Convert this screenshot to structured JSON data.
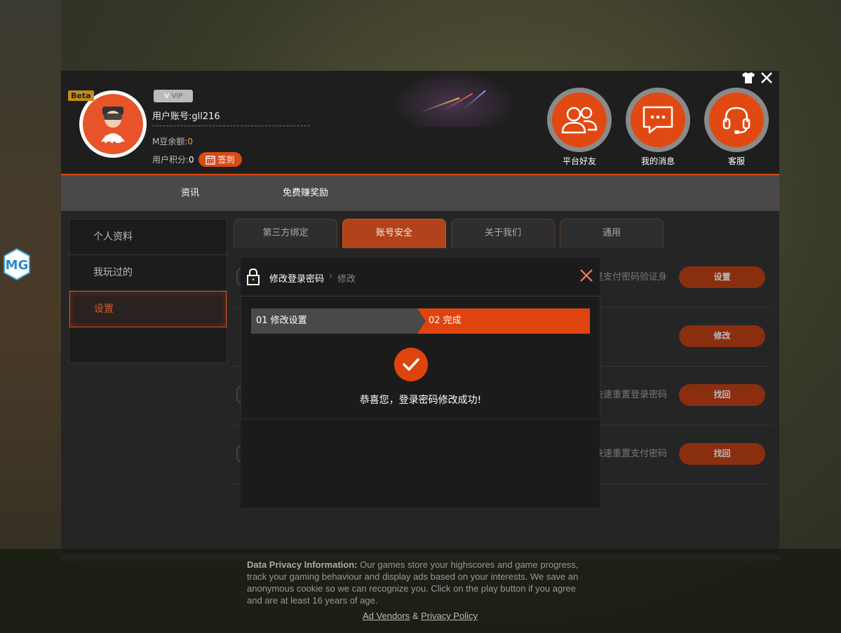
{
  "header": {
    "beta_badge": "Beta",
    "vip_label": "VIP",
    "account_label": "用户账号:",
    "account_value": "gll216",
    "balance_label": "M豆余额:",
    "balance_value": "0",
    "points_label": "用户积分:",
    "points_value": "0",
    "signin_label": "签到",
    "friends_label": "平台好友",
    "messages_label": "我的消息",
    "service_label": "客服"
  },
  "nav": {
    "items": [
      {
        "label": "资讯"
      },
      {
        "label": "免费赚奖励"
      }
    ]
  },
  "sidebar": {
    "items": [
      {
        "label": "个人资料",
        "active": false
      },
      {
        "label": "我玩过的",
        "active": false
      },
      {
        "label": "设置",
        "active": true
      }
    ]
  },
  "tabs": [
    {
      "label": "第三方绑定",
      "active": false
    },
    {
      "label": "账号安全",
      "active": true
    },
    {
      "label": "关于我们",
      "active": false
    },
    {
      "label": "通用",
      "active": false
    }
  ],
  "rows": [
    {
      "text": "是支付密码验证身",
      "button": "设置"
    },
    {
      "text": "",
      "button": "修改"
    },
    {
      "text": "快速重置登录密码",
      "button": "找回"
    },
    {
      "text": "快速重置支付密码",
      "button": "找回"
    }
  ],
  "modal": {
    "title": "修改登录密码",
    "separator": "›",
    "subtitle": "修改",
    "step1": "01 修改设置",
    "step2": "02 完成",
    "success": "恭喜您，登录密码修改成功!"
  },
  "privacy": {
    "heading": "Data Privacy Information:",
    "body": " Our games store your highscores and game progress, track your gaming behaviour and display ads based on your interests. We save an anonymous cookie so we can recognize you. Click on the play button if you agree and are at least 16 years of age.",
    "link1": "Ad Vendors",
    "amp": "&",
    "link2": "Privacy Policy"
  },
  "colors": {
    "accent": "#e0440e",
    "nav_bg": "#4a4848",
    "panel_bg": "#1c1b1b"
  }
}
